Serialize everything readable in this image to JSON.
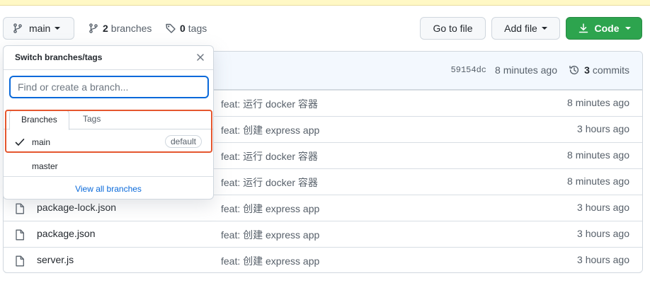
{
  "toolbar": {
    "branch_button": "main",
    "branches_count": "2",
    "branches_label": "branches",
    "tags_count": "0",
    "tags_label": "tags",
    "go_to_file": "Go to file",
    "add_file": "Add file",
    "code": "Code"
  },
  "commit_bar": {
    "sha": "59154dc",
    "time": "8 minutes ago",
    "commits_count": "3",
    "commits_label": "commits"
  },
  "files": [
    {
      "name": "",
      "message": "feat: 运行 docker 容器",
      "age": "8 minutes ago"
    },
    {
      "name": "",
      "message": "feat: 创建 express app",
      "age": "3 hours ago"
    },
    {
      "name": "",
      "message": "feat: 运行 docker 容器",
      "age": "8 minutes ago"
    },
    {
      "name": "",
      "message": "feat: 运行 docker 容器",
      "age": "8 minutes ago"
    },
    {
      "name": "package-lock.json",
      "message": "feat: 创建 express app",
      "age": "3 hours ago"
    },
    {
      "name": "package.json",
      "message": "feat: 创建 express app",
      "age": "3 hours ago"
    },
    {
      "name": "server.js",
      "message": "feat: 创建 express app",
      "age": "3 hours ago"
    }
  ],
  "dropdown": {
    "title": "Switch branches/tags",
    "search_placeholder": "Find or create a branch...",
    "tabs": {
      "branches": "Branches",
      "tags": "Tags"
    },
    "items": [
      {
        "name": "main",
        "badge": "default",
        "selected": true
      },
      {
        "name": "master"
      }
    ],
    "view_all": "View all branches"
  },
  "colors": {
    "accent_blue": "#0969da",
    "code_green": "#2da44e",
    "highlight": "#e5572f"
  }
}
